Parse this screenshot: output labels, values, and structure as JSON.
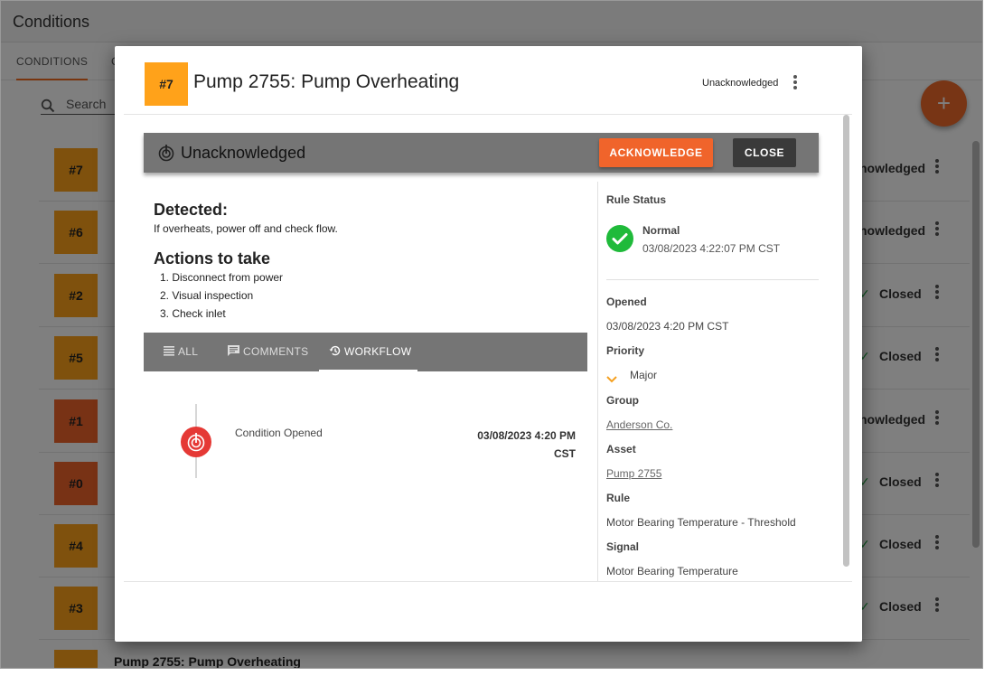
{
  "app": {
    "title": "Conditions"
  },
  "tabs": [
    {
      "label": "CONDITIONS"
    },
    {
      "label": "C"
    }
  ],
  "search": {
    "label": "Search"
  },
  "fab": {
    "icon": "plus-icon",
    "label": "+"
  },
  "rows": [
    {
      "number": "#7",
      "color": "#ffa21a",
      "status": "nowledged",
      "closed": false
    },
    {
      "number": "#6",
      "color": "#ffa21a",
      "status": "nowledged",
      "closed": false
    },
    {
      "number": "#2",
      "color": "#ffa21a",
      "status": "Closed",
      "closed": true
    },
    {
      "number": "#5",
      "color": "#ffa21a",
      "status": "Closed",
      "closed": true
    },
    {
      "number": "#1",
      "color": "#f0642b",
      "status": "nowledged",
      "closed": false
    },
    {
      "number": "#0",
      "color": "#f0642b",
      "status": "Closed",
      "closed": true
    },
    {
      "number": "#4",
      "color": "#ffa21a",
      "status": "Closed",
      "closed": true
    },
    {
      "number": "#3",
      "color": "#ffa21a",
      "status": "Closed",
      "closed": true
    },
    {
      "number": "",
      "color": "#ffa21a",
      "status": "",
      "closed": false,
      "title": "Pump 2755: Pump Overheating"
    }
  ],
  "modal": {
    "badge": "#7",
    "title": "Pump 2755: Pump Overheating",
    "header_status": "Unacknowledged",
    "status_bar": {
      "label": "Unacknowledged",
      "acknowledge": "ACKNOWLEDGE",
      "close": "CLOSE"
    },
    "detected": {
      "heading": "Detected:",
      "text": "If overheats, power off and check flow."
    },
    "actions": {
      "heading": "Actions to take",
      "items": [
        "1. Disconnect from power",
        "2. Visual inspection",
        "3. Check inlet"
      ]
    },
    "workflow_tabs": {
      "all": "ALL",
      "comments": "COMMENTS",
      "workflow": "WORKFLOW"
    },
    "timeline": {
      "label": "Condition Opened",
      "date_line1": "03/08/2023 4:20 PM",
      "date_line2": "CST"
    },
    "side": {
      "rule_status_heading": "Rule Status",
      "rule_status_value": "Normal",
      "rule_status_date": "03/08/2023 4:22:07 PM CST",
      "opened_heading": "Opened",
      "opened_value": "03/08/2023 4:20 PM CST",
      "priority_heading": "Priority",
      "priority_value": "Major",
      "group_heading": "Group",
      "group_value": "Anderson Co.",
      "asset_heading": "Asset",
      "asset_value": "Pump 2755",
      "rule_heading": "Rule",
      "rule_value": "Motor Bearing Temperature - Threshold",
      "signal_heading": "Signal",
      "signal_value": "Motor Bearing Temperature"
    }
  },
  "colors": {
    "accent": "#f0642b",
    "badge_amber": "#ffa21a",
    "ok": "#1fba3a",
    "danger": "#e53935"
  }
}
